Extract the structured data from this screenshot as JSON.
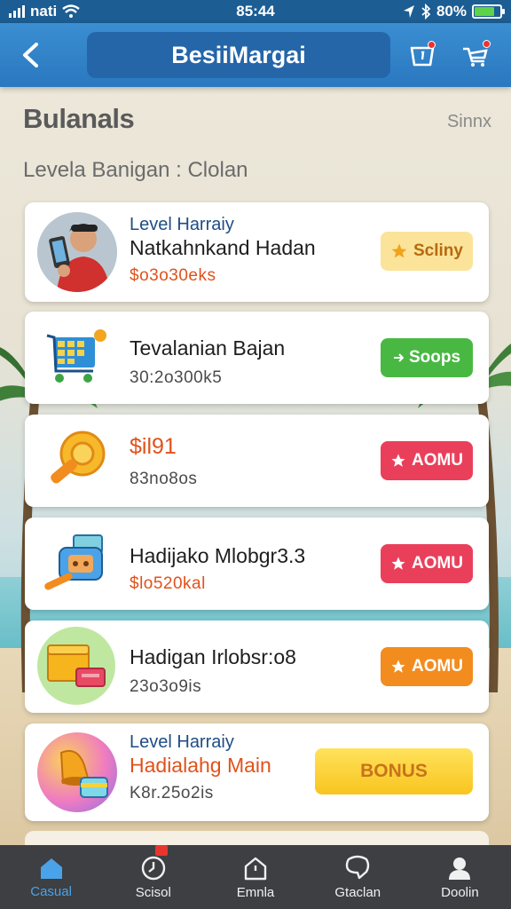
{
  "status_bar": {
    "carrier": "nati",
    "time": "85:44",
    "battery": "80%",
    "battery_level": 0.8
  },
  "app_bar": {
    "title": "BesiiMargai"
  },
  "section": {
    "title": "Bulanals",
    "link": "Sinnx",
    "subtitle": "Levela Banigan : Clolan"
  },
  "cards": [
    {
      "level": "Level Harraiy",
      "title": "Natkahnkand Hadan",
      "amount": "$o3o30eks",
      "button": "Scliny",
      "button_style": "yellow",
      "button_icon": "star-icon",
      "thumb": "player-avatar"
    },
    {
      "title": "Tevalanian Bajan",
      "amount": "30:2o300k5",
      "button": "Soops",
      "button_style": "green",
      "button_icon": "arrow-icon",
      "thumb": "shopping-cart-icon"
    },
    {
      "title": "$il91",
      "amount": "83no8os",
      "button": "AOMU",
      "button_style": "red",
      "button_icon": "star-icon",
      "thumb": "trophy-coin-icon"
    },
    {
      "title": "Hadijako Mlobgr3.3",
      "amount": "$lo520kal",
      "button": "AOMU",
      "button_style": "red",
      "button_icon": "star-icon",
      "thumb": "game-console-icon"
    },
    {
      "title": "Hadigan Irlobsr:o8",
      "amount": "23o3o9is",
      "button": "AOMU",
      "button_style": "orange",
      "button_icon": "star-icon",
      "thumb": "treasure-box-icon"
    },
    {
      "level": "Level Harraiy",
      "title": "Hadialahg Main",
      "amount": "K8r.25o2is",
      "button": "BONUS",
      "button_style": "bonus",
      "thumb": "bell-gift-icon"
    }
  ],
  "bottom_nav": {
    "items": [
      {
        "label": "Casual",
        "icon": "home-icon",
        "active": true
      },
      {
        "label": "Scisol",
        "icon": "clock-icon",
        "badge": true
      },
      {
        "label": "Emnla",
        "icon": "house-outline-icon"
      },
      {
        "label": "Gtaclan",
        "icon": "chat-heart-icon"
      },
      {
        "label": "Doolin",
        "icon": "profile-icon"
      }
    ]
  },
  "colors": {
    "status_bar": "#1c5d93",
    "app_bar": "#2a78c0",
    "title_pill": "#2566a9",
    "bottom_nav": "#3d3f43",
    "active_nav": "#4aa3e8",
    "btn_yellow": "#fbe39a",
    "btn_green": "#49b843",
    "btn_red": "#ea3f5a",
    "btn_orange": "#f28c1e",
    "amount_orange": "#e0521b"
  }
}
